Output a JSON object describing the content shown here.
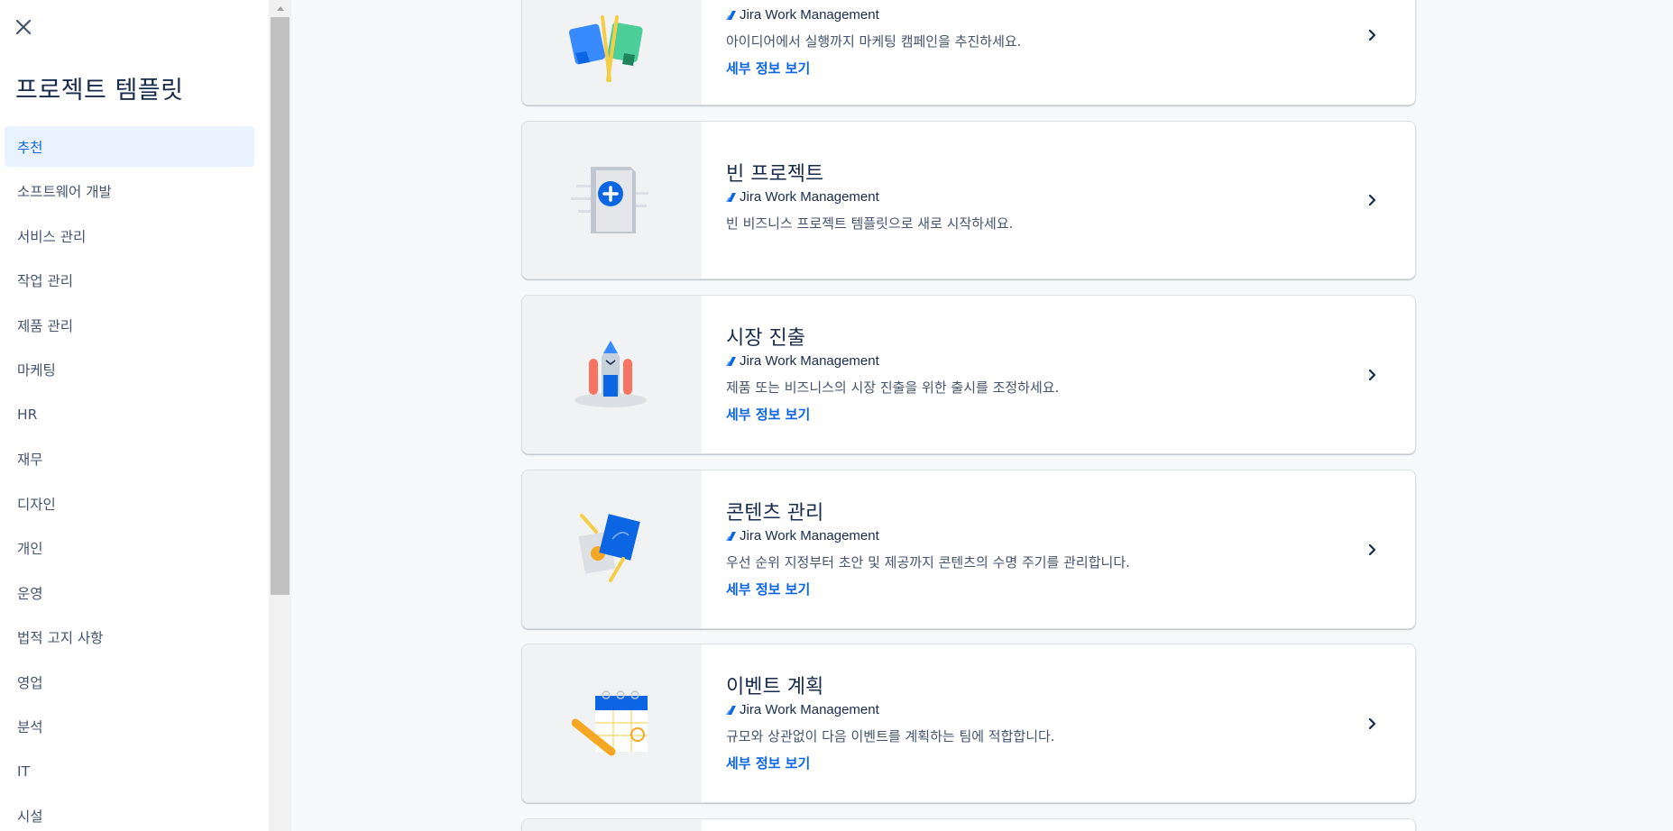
{
  "sidebar": {
    "title": "프로젝트 템플릿",
    "items": [
      {
        "label": "추천",
        "active": true
      },
      {
        "label": "소프트웨어 개발"
      },
      {
        "label": "서비스 관리"
      },
      {
        "label": "작업 관리"
      },
      {
        "label": "제품 관리"
      },
      {
        "label": "마케팅"
      },
      {
        "label": "HR"
      },
      {
        "label": "재무"
      },
      {
        "label": "디자인"
      },
      {
        "label": "개인"
      },
      {
        "label": "운영"
      },
      {
        "label": "법적 고지 사항"
      },
      {
        "label": "영업"
      },
      {
        "label": "분석"
      },
      {
        "label": "IT"
      },
      {
        "label": "시설"
      }
    ]
  },
  "cards": [
    {
      "title": "",
      "product": "Jira Work Management",
      "description": "아이디어에서 실행까지 마케팅 캠페인을 추진하세요.",
      "link": "세부 정보 보기",
      "image_icon": "flags-illustration"
    },
    {
      "title": "빈 프로젝트",
      "product": "Jira Work Management",
      "description": "빈 비즈니스 프로젝트 템플릿으로 새로 시작하세요.",
      "link": "",
      "image_icon": "blank-project-illustration"
    },
    {
      "title": "시장 진출",
      "product": "Jira Work Management",
      "description": "제품 또는 비즈니스의 시장 진출을 위한 출시를 조정하세요.",
      "link": "세부 정보 보기",
      "image_icon": "rocket-illustration"
    },
    {
      "title": "콘텐츠 관리",
      "product": "Jira Work Management",
      "description": "우선 순위 지정부터 초안 및 제공까지 콘텐츠의 수명 주기를 관리합니다.",
      "link": "세부 정보 보기",
      "image_icon": "documents-illustration"
    },
    {
      "title": "이벤트 계획",
      "product": "Jira Work Management",
      "description": "규모와 상관없이 다음 이벤트를 계획하는 팀에 적합합니다.",
      "link": "세부 정보 보기",
      "image_icon": "calendar-illustration"
    }
  ],
  "colors": {
    "accent": "#0c66e4",
    "active_bg": "#e9f2ff",
    "text": "#172b4d",
    "subtle": "#44546f"
  }
}
